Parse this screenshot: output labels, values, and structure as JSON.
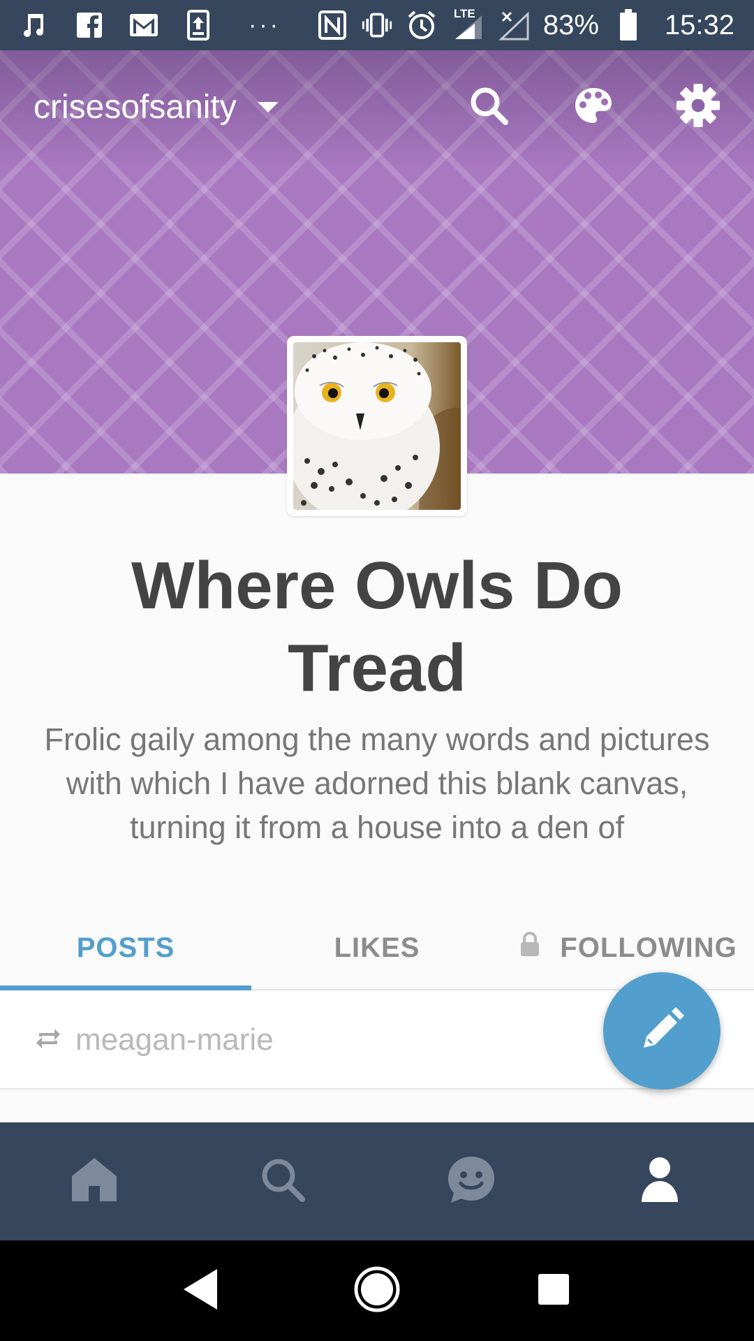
{
  "status_bar": {
    "left_icons": [
      "music-note-icon",
      "facebook-icon",
      "gmail-icon",
      "upload-icon",
      "more-dots-icon"
    ],
    "right_icons": [
      "nfc-icon",
      "vibrate-icon",
      "alarm-icon",
      "lte-signal-icon",
      "no-signal-icon",
      "battery-icon"
    ],
    "lte_label": "LTE",
    "battery": "83%",
    "time": "15:32"
  },
  "header": {
    "blog_name": "crisesofsanity",
    "background_color": "#a878c1",
    "icons": [
      "search-icon",
      "palette-icon",
      "gear-icon"
    ]
  },
  "blog": {
    "title": "Where Owls Do Tread",
    "description": "Frolic gaily among the many words and pictures with which I have adorned this blank canvas, turning it from a house into a den of"
  },
  "tabs": [
    {
      "label": "POSTS",
      "active": true
    },
    {
      "label": "LIKES",
      "active": false
    },
    {
      "label": "FOLLOWING",
      "active": false,
      "locked": true
    }
  ],
  "post": {
    "reblog_user": "meagan-marie"
  },
  "bottom_nav": [
    "home-icon",
    "search-icon",
    "activity-icon",
    "account-icon"
  ],
  "colors": {
    "accent": "#529ecc",
    "nav_bg": "#36465d"
  }
}
